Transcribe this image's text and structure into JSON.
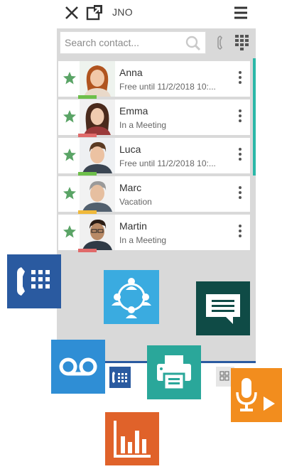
{
  "header": {
    "title": "JNO",
    "close_icon": "close-icon",
    "popout_icon": "popout-icon",
    "menu_icon": "hamburger-menu-icon"
  },
  "search": {
    "placeholder": "Search contact...",
    "icon": "search-icon"
  },
  "toolbar": {
    "phone_icon": "phone-icon",
    "dialpad_icon": "dialpad-icon"
  },
  "contacts": [
    {
      "name": "Anna",
      "status": "Free until 11/2/2018 10:...",
      "status_color": "#6dbf4a",
      "favorite": true
    },
    {
      "name": "Emma",
      "status": "In a Meeting",
      "status_color": "#e06a6a",
      "favorite": true
    },
    {
      "name": "Luca",
      "status": "Free until 11/2/2018 10:...",
      "status_color": "#6dbf4a",
      "favorite": true
    },
    {
      "name": "Marc",
      "status": "Vacation",
      "status_color": "#f0b93a",
      "favorite": true
    },
    {
      "name": "Martin",
      "status": "In a Meeting",
      "status_color": "#e06a6a",
      "favorite": true
    }
  ],
  "colors": {
    "accent": "#2cb8a8",
    "star": "#5aa466",
    "phone_tile": "#2a5aa0",
    "conference_tile": "#3aabe0",
    "chat_tile": "#0f4b46",
    "voicemail_tile": "#2f8ed5",
    "fax_tile": "#2aa79a",
    "recorder_tile": "#f28d1e",
    "reports_tile": "#e0622a"
  },
  "tiles": [
    {
      "name": "desk-phone-tile",
      "icon": "desk-phone-icon"
    },
    {
      "name": "conference-tile",
      "icon": "conference-icon"
    },
    {
      "name": "chat-tile",
      "icon": "chat-icon"
    },
    {
      "name": "voicemail-tile",
      "icon": "voicemail-icon"
    },
    {
      "name": "fax-tile",
      "icon": "fax-icon"
    },
    {
      "name": "voice-recorder-tile",
      "icon": "microphone-play-icon"
    },
    {
      "name": "reports-tile",
      "icon": "bar-chart-icon"
    }
  ]
}
